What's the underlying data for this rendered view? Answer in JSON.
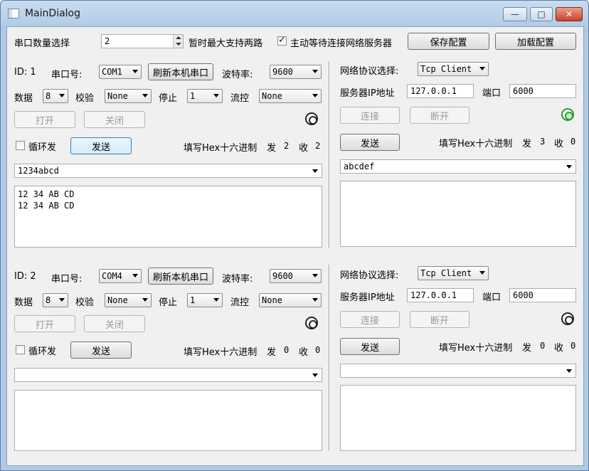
{
  "window": {
    "title": "MainDialog",
    "minimize_glyph": "—",
    "maximize_glyph": "□",
    "close_glyph": "✕"
  },
  "top": {
    "serial_count_label": "串口数量选择",
    "serial_count_value": "2",
    "max_support_text": "暂时最大支持两路",
    "wait_server_label": "主动等待连接网络服务器",
    "wait_server_checked": true,
    "save_button": "保存配置",
    "load_button": "加载配置"
  },
  "serial_panels": [
    {
      "id_label": "ID: 1",
      "port_label": "串口号:",
      "port_value": "COM1",
      "refresh_button": "刷新本机串口",
      "baud_label": "波特率:",
      "baud_value": "9600",
      "data_label": "数据",
      "data_value": "8",
      "parity_label": "校验",
      "parity_value": "None",
      "stop_label": "停止",
      "stop_value": "1",
      "flow_label": "流控",
      "flow_value": "None",
      "open_button": "打开",
      "close_button": "关闭",
      "loop_label": "循环发",
      "send_button": "发送",
      "hex_label": "填写Hex十六进制",
      "sent_label": "发",
      "sent_count": "2",
      "recv_label": "收",
      "recv_count": "2",
      "send_text": "1234abcd",
      "receive_text": "12 34 AB CD\n12 34 AB CD"
    },
    {
      "id_label": "ID: 2",
      "port_label": "串口号:",
      "port_value": "COM4",
      "refresh_button": "刷新本机串口",
      "baud_label": "波特率:",
      "baud_value": "9600",
      "data_label": "数据",
      "data_value": "8",
      "parity_label": "校验",
      "parity_value": "None",
      "stop_label": "停止",
      "stop_value": "1",
      "flow_label": "流控",
      "flow_value": "None",
      "open_button": "打开",
      "close_button": "关闭",
      "loop_label": "循环发",
      "send_button": "发送",
      "hex_label": "填写Hex十六进制",
      "sent_label": "发",
      "sent_count": "0",
      "recv_label": "收",
      "recv_count": "0",
      "send_text": "",
      "receive_text": ""
    }
  ],
  "net_panels": [
    {
      "protocol_label": "网络协议选择:",
      "protocol_value": "Tcp Client",
      "ip_label": "服务器IP地址",
      "ip_value": "127.0.0.1",
      "port_label": "端口",
      "port_value": "6000",
      "connect_button": "连接",
      "disconnect_button": "断开",
      "status": "connected",
      "send_button": "发送",
      "hex_label": "填写Hex十六进制",
      "sent_label": "发",
      "sent_count": "3",
      "recv_label": "收",
      "recv_count": "0",
      "send_text": "abcdef",
      "receive_text": ""
    },
    {
      "protocol_label": "网络协议选择:",
      "protocol_value": "Tcp Client",
      "ip_label": "服务器IP地址",
      "ip_value": "127.0.0.1",
      "port_label": "端口",
      "port_value": "6000",
      "connect_button": "连接",
      "disconnect_button": "断开",
      "status": "disconnected",
      "send_button": "发送",
      "hex_label": "填写Hex十六进制",
      "sent_label": "发",
      "sent_count": "0",
      "recv_label": "收",
      "recv_count": "0",
      "send_text": "",
      "receive_text": ""
    }
  ],
  "colors": {
    "led_on": "#2d9a2d",
    "led_off": "#222222",
    "title_bar": "#b2cbe6"
  }
}
